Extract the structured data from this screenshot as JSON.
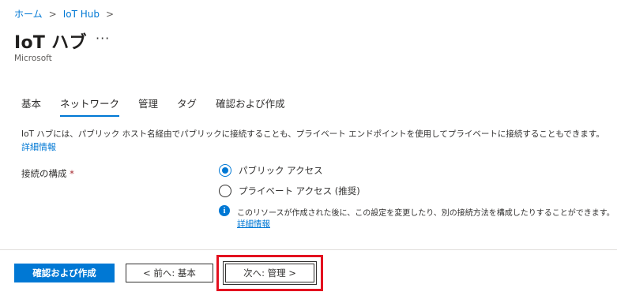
{
  "breadcrumb": {
    "home": "ホーム",
    "iothub": "IoT Hub",
    "sep": ">"
  },
  "header": {
    "title": "IoT ハブ",
    "more": "···",
    "publisher": "Microsoft"
  },
  "tabs": [
    {
      "label": "基本",
      "active": false
    },
    {
      "label": "ネットワーク",
      "active": true
    },
    {
      "label": "管理",
      "active": false
    },
    {
      "label": "タグ",
      "active": false
    },
    {
      "label": "確認および作成",
      "active": false
    }
  ],
  "network": {
    "description": "IoT ハブには、パブリック ホスト名経由でパブリックに接続することも、プライベート エンドポイントを使用してプライベートに接続することもできます。",
    "learn_more": "詳細情報",
    "connectivity_label": "接続の構成",
    "required_mark": "*",
    "options": [
      {
        "label": "パブリック アクセス",
        "selected": true
      },
      {
        "label": "プライベート アクセス (推奨)",
        "selected": false
      }
    ],
    "info_text": "このリソースが作成された後に、この設定を変更したり、別の接続方法を構成したりすることができます。",
    "info_link": "詳細情報"
  },
  "footer": {
    "review_create": "確認および作成",
    "previous": "< 前へ: 基本",
    "next": "次へ: 管理 >"
  },
  "colors": {
    "accent": "#0078d4",
    "highlight": "#e3101f",
    "required": "#a4262c"
  }
}
